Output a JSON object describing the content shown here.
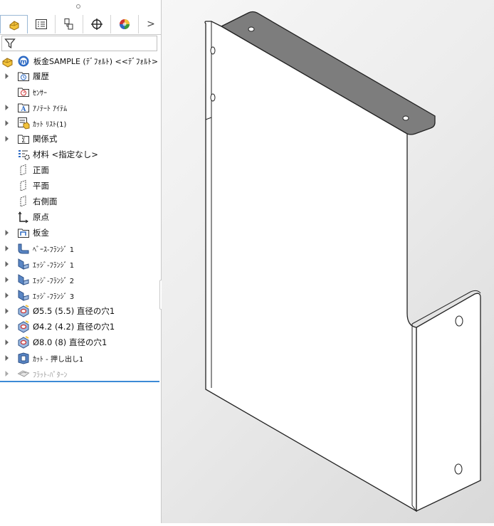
{
  "tabs": [
    {
      "name": "featuremanager",
      "icon": "featuremanager-icon",
      "active": true
    },
    {
      "name": "propertymanager",
      "icon": "propertymanager-icon"
    },
    {
      "name": "configurationmanager",
      "icon": "configuration-icon"
    },
    {
      "name": "dimxpert",
      "icon": "target-icon"
    },
    {
      "name": "display",
      "icon": "display-sphere-icon"
    }
  ],
  "tabs_more": ">",
  "filter": {
    "icon": "filter-icon",
    "value": ""
  },
  "tree": {
    "root_label": "板金SAMPLE (ﾃﾞﾌｫﾙﾄ) <<ﾃﾞﾌｫﾙﾄ>",
    "items": [
      {
        "label": "履歴",
        "icon": "history-icon",
        "expandable": true
      },
      {
        "label": "ｾﾝｻｰ",
        "icon": "sensor-icon",
        "expandable": false
      },
      {
        "label": "ｱﾉﾃｰﾄ ｱｲﾃﾑ",
        "icon": "annotation-icon",
        "expandable": true
      },
      {
        "label": "ｶｯﾄ ﾘｽﾄ(1)",
        "icon": "cutlist-icon",
        "expandable": true
      },
      {
        "label": "関係式",
        "icon": "equation-icon",
        "expandable": true
      },
      {
        "label": "材料 <指定なし>",
        "icon": "material-icon",
        "expandable": false
      },
      {
        "label": "正面",
        "icon": "plane-icon",
        "expandable": false
      },
      {
        "label": "平面",
        "icon": "plane-icon",
        "expandable": false
      },
      {
        "label": "右側面",
        "icon": "plane-icon",
        "expandable": false
      },
      {
        "label": "原点",
        "icon": "origin-icon",
        "expandable": false
      },
      {
        "label": "板金",
        "icon": "sheetmetal-icon",
        "expandable": true
      },
      {
        "label": "ﾍﾞｰｽ-ﾌﾗﾝｼﾞ 1",
        "icon": "base-flange-icon",
        "expandable": true
      },
      {
        "label": "ｴｯｼﾞ-ﾌﾗﾝｼﾞ 1",
        "icon": "edge-flange-icon",
        "expandable": true
      },
      {
        "label": "ｴｯｼﾞ-ﾌﾗﾝｼﾞ 2",
        "icon": "edge-flange-icon",
        "expandable": true
      },
      {
        "label": "ｴｯｼﾞ-ﾌﾗﾝｼﾞ 3",
        "icon": "edge-flange-icon",
        "expandable": true
      },
      {
        "label": "Ø5.5 (5.5) 直径の穴1",
        "icon": "hole-icon",
        "expandable": true
      },
      {
        "label": "Ø4.2 (4.2) 直径の穴1",
        "icon": "hole-icon",
        "expandable": true
      },
      {
        "label": "Ø8.0 (8) 直径の穴1",
        "icon": "hole-icon",
        "expandable": true
      },
      {
        "label": "ｶｯﾄ - 押し出し1",
        "icon": "cut-extrude-icon",
        "expandable": true
      },
      {
        "label": "ﾌﾗｯﾄ-ﾊﾟﾀｰﾝ",
        "icon": "flat-pattern-icon",
        "expandable": true,
        "suppressed": true
      }
    ]
  },
  "colors": {
    "accent": "#3c8ad6",
    "part_face": "#ffffff",
    "part_top": "#7d7d7d",
    "viewport_bg": "#e6e6e6"
  }
}
